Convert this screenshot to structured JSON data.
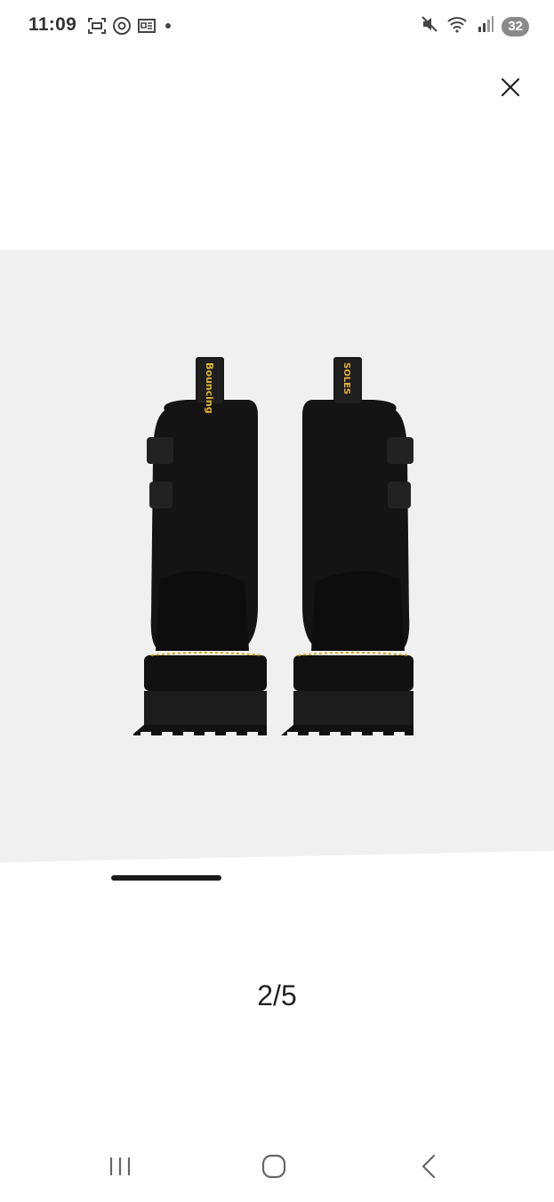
{
  "status_bar": {
    "time": "11:09",
    "left_icons": [
      "screenshot-icon",
      "threads-icon",
      "news-icon",
      "dot-icon"
    ],
    "right_icons": [
      "mute-icon",
      "wifi-icon",
      "signal-icon"
    ],
    "battery": "32"
  },
  "viewer": {
    "close_icon": "close-icon",
    "image_alt": "Black leather platform boots, rear view",
    "pull_tab_text_left": "Bouncing",
    "pull_tab_text_right": "SOLES",
    "page_counter": "2/5",
    "progress": 0.2
  },
  "nav_bar": {
    "recents_icon": "recents-icon",
    "home_icon": "home-icon",
    "back_icon": "back-icon"
  }
}
